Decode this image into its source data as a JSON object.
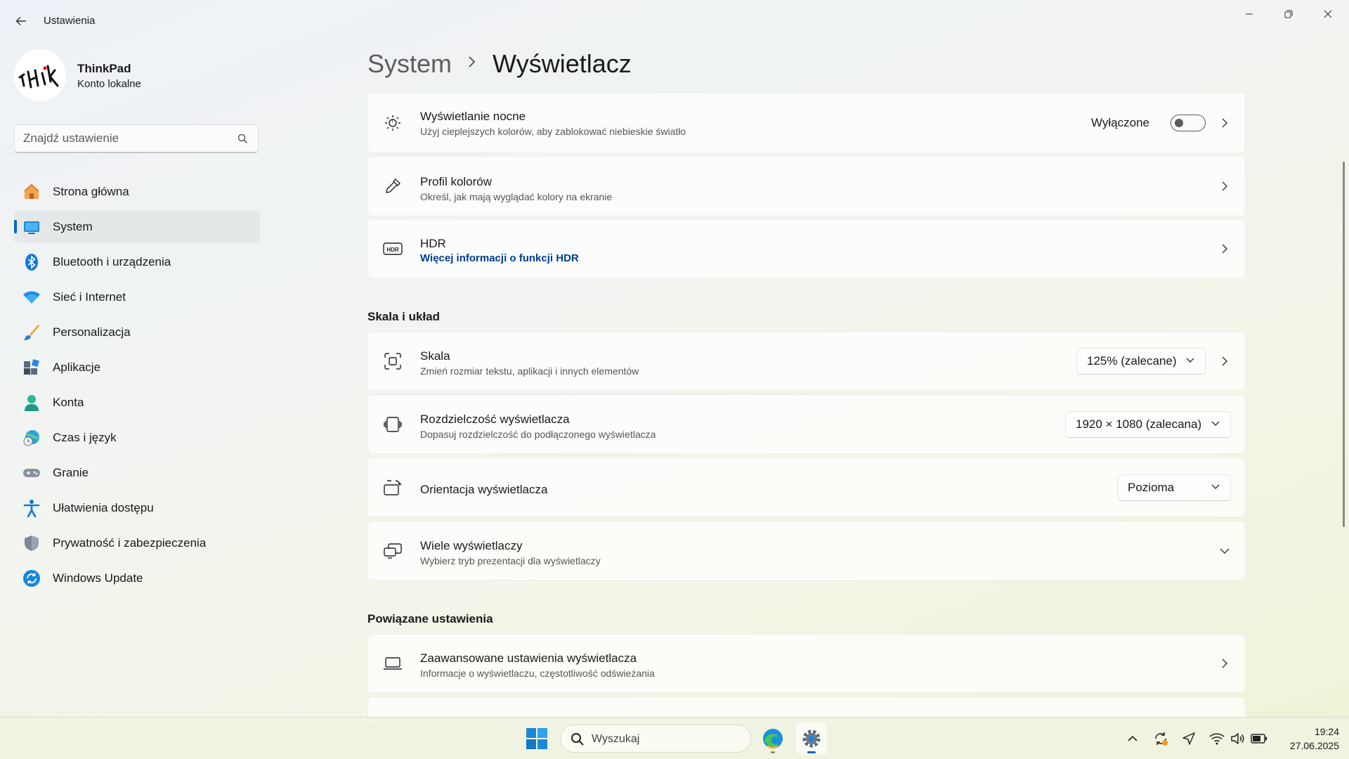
{
  "window": {
    "title": "Ustawienia"
  },
  "profile": {
    "name": "ThinkPad",
    "account": "Konto lokalne"
  },
  "search": {
    "placeholder": "Znajdź ustawienie"
  },
  "nav": {
    "items": [
      {
        "label": "Strona główna",
        "icon": "home-icon"
      },
      {
        "label": "System",
        "icon": "system-icon",
        "active": true
      },
      {
        "label": "Bluetooth i urządzenia",
        "icon": "bluetooth-icon"
      },
      {
        "label": "Sieć i Internet",
        "icon": "wifi-icon"
      },
      {
        "label": "Personalizacja",
        "icon": "brush-icon"
      },
      {
        "label": "Aplikacje",
        "icon": "apps-icon"
      },
      {
        "label": "Konta",
        "icon": "account-icon"
      },
      {
        "label": "Czas i język",
        "icon": "globe-clock-icon"
      },
      {
        "label": "Granie",
        "icon": "gamepad-icon"
      },
      {
        "label": "Ułatwienia dostępu",
        "icon": "accessibility-icon"
      },
      {
        "label": "Prywatność i zabezpieczenia",
        "icon": "shield-icon"
      },
      {
        "label": "Windows Update",
        "icon": "update-icon"
      }
    ]
  },
  "breadcrumb": {
    "parent": "System",
    "current": "Wyświetlacz"
  },
  "cards": {
    "night_light": {
      "title": "Wyświetlanie nocne",
      "subtitle": "Użyj cieplejszych kolorów, aby zablokować niebieskie światło",
      "state_label": "Wyłączone"
    },
    "color_profile": {
      "title": "Profil kolorów",
      "subtitle": "Określ, jak mają wyglądać kolory na ekranie"
    },
    "hdr": {
      "title": "HDR",
      "link": "Więcej informacji o funkcji HDR"
    }
  },
  "section_scale": {
    "heading": "Skala i układ",
    "scale": {
      "title": "Skala",
      "subtitle": "Zmień rozmiar tekstu, aplikacji i innych elementów",
      "value": "125% (zalecane)"
    },
    "resolution": {
      "title": "Rozdzielczość wyświetlacza",
      "subtitle": "Dopasuj rozdzielczość do podłączonego wyświetlacza",
      "value": "1920 × 1080 (zalecana)"
    },
    "orientation": {
      "title": "Orientacja wyświetlacza",
      "value": "Pozioma"
    },
    "multiple": {
      "title": "Wiele wyświetlaczy",
      "subtitle": "Wybierz tryb prezentacji dla wyświetlaczy"
    }
  },
  "section_related": {
    "heading": "Powiązane ustawienia",
    "advanced": {
      "title": "Zaawansowane ustawienia wyświetlacza",
      "subtitle": "Informacje o wyświetlaczu, częstotliwość odświeżania"
    }
  },
  "taskbar": {
    "search_label": "Wyszukaj",
    "time": "19:24",
    "date": "27.06.2025"
  },
  "colors": {
    "accent": "#0067c0",
    "link": "#003e92"
  }
}
